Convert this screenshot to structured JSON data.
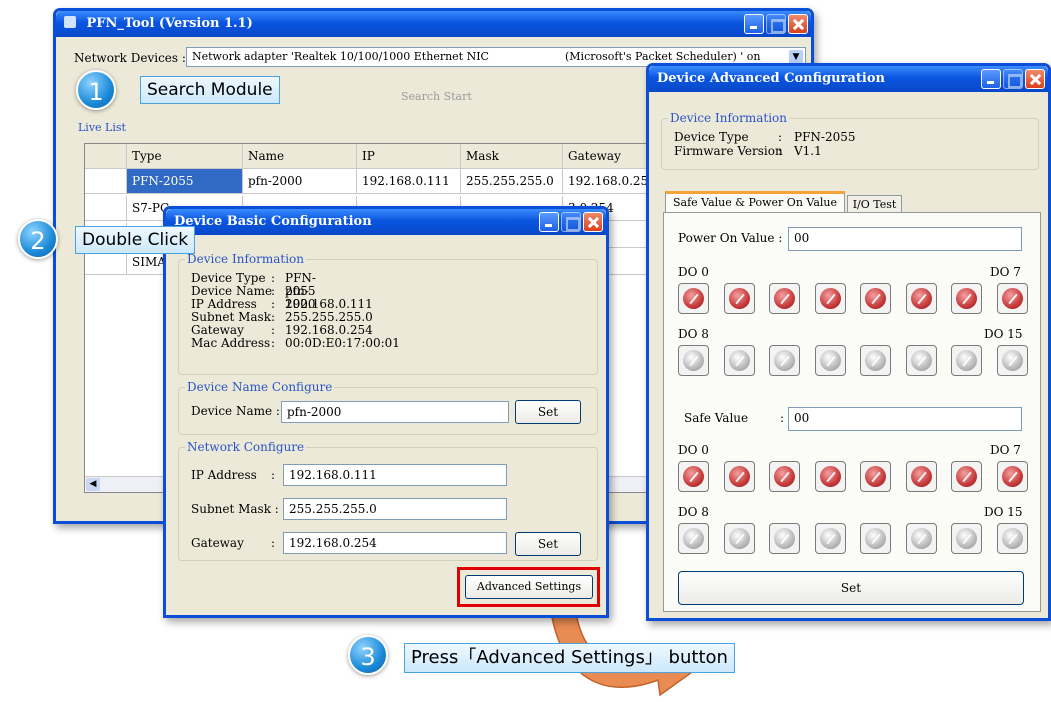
{
  "main_window": {
    "title": "PFN_Tool (Version 1.1)",
    "network_devices_label": "Network Devices :",
    "network_adapter_value": "Network adapter 'Realtek 10/100/1000 Ethernet NIC",
    "network_adapter_suffix": "(Microsoft's Packet Scheduler) ' on",
    "search_start_label": "Search Start",
    "live_list_label": "Live List",
    "columns": [
      "Type",
      "Name",
      "IP",
      "Mask",
      "Gateway"
    ],
    "rows": [
      [
        "PFN-2055",
        "pfn-2000",
        "192.168.0.111",
        "255.255.255.0",
        "192.168.0.254"
      ],
      [
        "S7-PC",
        "",
        "",
        "",
        "3.0.254"
      ],
      [
        "",
        "",
        "",
        "",
        ""
      ],
      [
        "SIMA",
        "",
        "",
        "",
        ""
      ]
    ]
  },
  "basic_dialog": {
    "title": "Device Basic Configuration",
    "device_info_label": "Device Information",
    "info_lines": [
      {
        "k": "Device Type",
        "v": "PFN-2055"
      },
      {
        "k": "Device Name",
        "v": "pfn-2000"
      },
      {
        "k": "IP Address",
        "v": "192.168.0.111"
      },
      {
        "k": "Subnet Mask",
        "v": "255.255.255.0"
      },
      {
        "k": "Gateway",
        "v": "192.168.0.254"
      },
      {
        "k": "Mac Address",
        "v": "00:0D:E0:17:00:01"
      }
    ],
    "name_cfg_label": "Device Name Configure",
    "device_name_label": "Device Name :",
    "device_name_value": "pfn-2000",
    "set_label": "Set",
    "network_cfg_label": "Network Configure",
    "ip_label": "IP Address",
    "ip_value": "192.168.0.111",
    "mask_label": "Subnet Mask :",
    "mask_value": "255.255.255.0",
    "gw_label": "Gateway",
    "gw_value": "192.168.0.254",
    "set2_label": "Set",
    "advanced_label": "Advanced Settings"
  },
  "advanced_dialog": {
    "title": "Device Advanced Configuration",
    "device_info_label": "Device Information",
    "device_type_label": "Device Type",
    "device_type_value": "PFN-2055",
    "fw_label": "Firmware Version",
    "fw_value": "V1.1",
    "tab_safe": "Safe Value & Power On Value",
    "tab_io": "I/O Test",
    "power_on_label": "Power On Value :",
    "power_on_value": "00",
    "do0": "DO 0",
    "do7": "DO 7",
    "do8": "DO 8",
    "do15": "DO 15",
    "safe_label": "Safe Value",
    "safe_colon": ":",
    "safe_value": "00",
    "set_label": "Set"
  },
  "callouts": {
    "step1_num": "1",
    "step1_text": "Search Module",
    "step2_num": "2",
    "step2_text": "Double Click",
    "step3_num": "3",
    "step3_text": "Press「Advanced Settings」 button"
  },
  "colors": {
    "title_bar": "#0a55e0",
    "highlight_red": "#e00000",
    "callout_arrow": "#e8864a",
    "knob_on": "#c63a3a",
    "knob_off": "#b9b9b9"
  }
}
